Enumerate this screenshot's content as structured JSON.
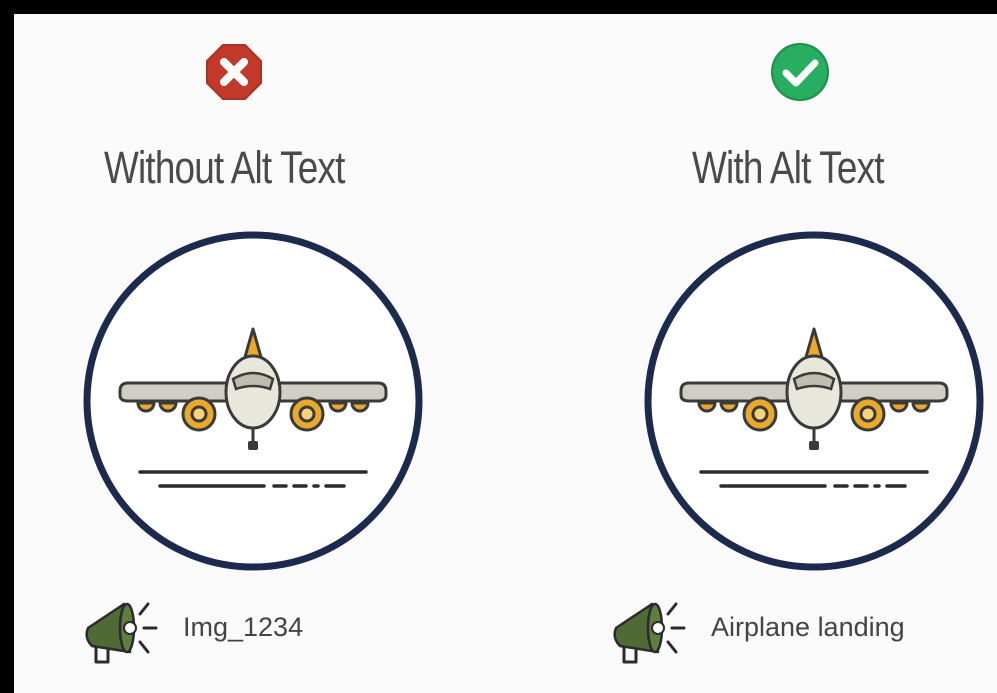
{
  "left": {
    "status_icon": "x-octagon-icon",
    "heading": "Without Alt Text",
    "illustration_icon": "airplane-landing-icon",
    "speaker_icon": "megaphone-icon",
    "caption": "Img_1234"
  },
  "right": {
    "status_icon": "check-circle-icon",
    "heading": "With Alt Text",
    "illustration_icon": "airplane-landing-icon",
    "speaker_icon": "megaphone-icon",
    "caption": "Airplane landing"
  },
  "colors": {
    "page_background": "#fafafa",
    "outer_border": "#000000",
    "heading_text": "#4a4a4a",
    "caption_text": "#444444",
    "error_red": "#c0392b",
    "success_green": "#27ae60",
    "circle_outline": "#1c2a4d",
    "wheel_orange": "#e9a92a",
    "plane_body": "#e8e7dc",
    "megaphone_green": "#4f6b35"
  }
}
